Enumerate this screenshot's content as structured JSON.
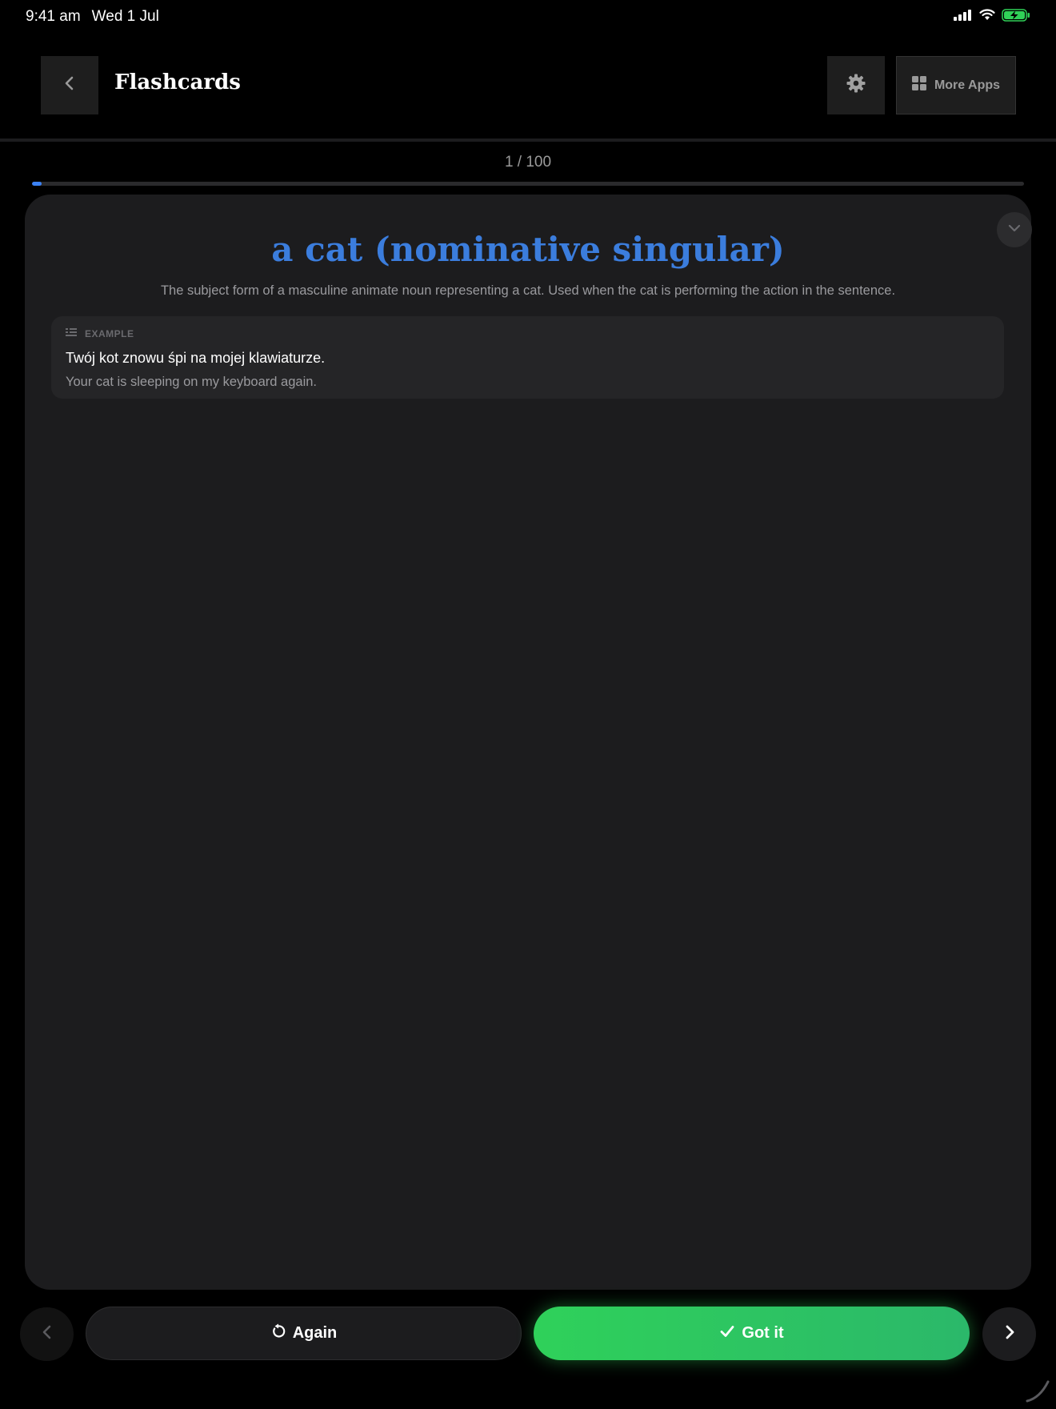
{
  "status_bar": {
    "time": "9:41 am",
    "date": "Wed 1 Jul",
    "icons": [
      "cellular-signal-icon",
      "wifi-icon",
      "battery-charging-icon"
    ]
  },
  "header": {
    "title": "Flashcards",
    "back_icon": "chevron-left-icon",
    "settings_icon": "gear-icon",
    "more_apps_label": "More Apps",
    "more_apps_icon": "grid-icon"
  },
  "progress": {
    "label": "1 / 100",
    "current": 1,
    "total": 100,
    "fraction": 0.01,
    "color": "#3b82f6"
  },
  "card": {
    "term": "a cat (nominative singular)",
    "definition": "The subject form of a masculine animate noun representing a cat. Used when the cat is performing the action in the sentence.",
    "collapse_icon": "chevron-down-icon",
    "term_color": "#3b7ddd",
    "example": {
      "label": "EXAMPLE",
      "icon": "list-icon",
      "text": "Twój kot znowu śpi na mojej klawiaturze.",
      "translation": "Your cat is sleeping on my keyboard again."
    }
  },
  "controls": {
    "prev_icon": "chevron-left-icon",
    "again_label": "Again",
    "again_icon": "refresh-icon",
    "got_it_label": "Got it",
    "got_it_icon": "checkmark-icon",
    "got_it_color": "#30d158",
    "next_icon": "chevron-right-icon"
  }
}
